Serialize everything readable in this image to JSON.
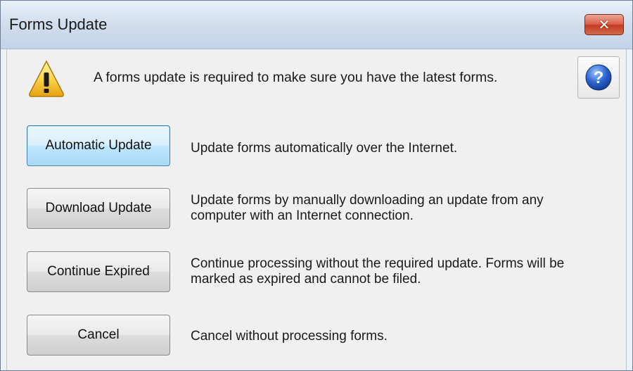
{
  "window": {
    "title": "Forms Update",
    "close_label": "✕"
  },
  "header": {
    "message": "A forms update is required to make sure you have the latest forms.",
    "help_glyph": "?"
  },
  "options": [
    {
      "button": "Automatic Update",
      "line1": "Update forms automatically over the Internet.",
      "line2": ""
    },
    {
      "button": "Download Update",
      "line1": "Update forms by manually downloading an update from any",
      "line2": "computer with an Internet connection."
    },
    {
      "button": "Continue Expired",
      "line1": "Continue processing without the required update. Forms will be",
      "line2": "marked as expired and cannot be filed."
    },
    {
      "button": "Cancel",
      "line1": "Cancel without processing forms.",
      "line2": ""
    }
  ],
  "icons": {
    "warning": "warning-icon",
    "help": "help-icon",
    "close": "close-icon"
  },
  "colors": {
    "default_button_border": "#3c7fb1",
    "close_button": "#c23a22",
    "help_blue": "#2b62d0"
  }
}
